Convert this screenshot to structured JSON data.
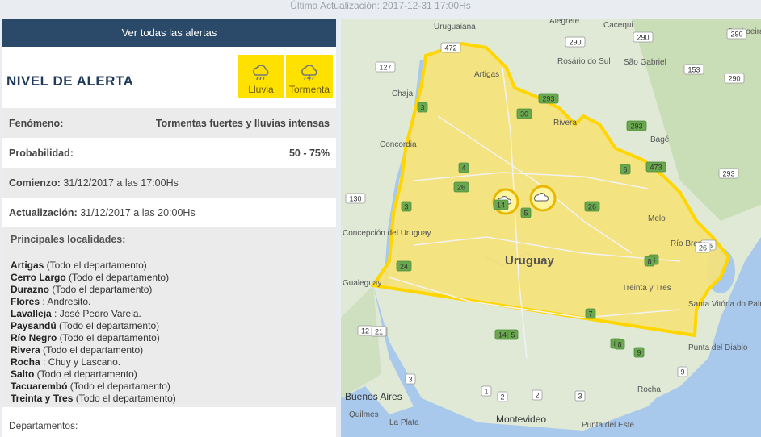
{
  "header": {
    "last_update": "Última Actualización: 2017-12-31 17:00Hs"
  },
  "panel": {
    "view_all_label": "Ver todas las alertas",
    "alert_level_title": "NIVEL DE ALERTA",
    "alert_icons": [
      {
        "label": "Lluvia",
        "icon": "rain-cloud-icon"
      },
      {
        "label": "Tormenta",
        "icon": "storm-cloud-icon"
      }
    ],
    "phenomenon_label": "Fenómeno:",
    "phenomenon_value": "Tormentas fuertes y lluvias intensas",
    "probability_label": "Probabilidad:",
    "probability_value": "50 - 75%",
    "start_label": "Comienzo:",
    "start_value": "31/12/2017 a las 17:00Hs",
    "update_label": "Actualización:",
    "update_value": "31/12/2017 a las 20:00Hs",
    "localities_title": "Principales localidades:",
    "localities": [
      {
        "name": "Artigas",
        "detail": "(Todo el departamento)"
      },
      {
        "name": "Cerro Largo",
        "detail": "(Todo el departamento)"
      },
      {
        "name": "Durazno",
        "detail": "(Todo el departamento)"
      },
      {
        "name": "Flores",
        "detail": ": Andresito."
      },
      {
        "name": "Lavalleja",
        "detail": ": José Pedro Varela."
      },
      {
        "name": "Paysandú",
        "detail": "(Todo el departamento)"
      },
      {
        "name": "Río Negro",
        "detail": "(Todo el departamento)"
      },
      {
        "name": "Rivera",
        "detail": "(Todo el departamento)"
      },
      {
        "name": "Rocha",
        "detail": ": Chuy y Lascano."
      },
      {
        "name": "Salto",
        "detail": "(Todo el departamento)"
      },
      {
        "name": "Tacuarembó",
        "detail": "(Todo el departamento)"
      },
      {
        "name": "Treinta y Tres",
        "detail": "(Todo el departamento)"
      }
    ],
    "departments_label": "Departamentos:"
  },
  "map": {
    "highlight_color": "#f5e27a",
    "border_color": "#ffd600",
    "cities": {
      "uruguaiana": "Uruguaiana",
      "alegrete": "Alegrete",
      "cacequi": "Cacequi",
      "rosario": "Rosário do Sul",
      "sao_gabriel": "São Gabriel",
      "cachoeira": "Cachoeira do Sul",
      "artigas": "Artigas",
      "chaja": "Chaja",
      "rivera": "Rivera",
      "bage": "Bagé",
      "concordia": "Concordia",
      "concepcion": "Concepción del Uruguay",
      "melo": "Melo",
      "rio_branco": "Río Branco",
      "uruguay": "Uruguay",
      "treinta_y_tres": "Treinta y Tres",
      "santa_vitoria": "Santa Vitória do Palmar",
      "gualeguay": "Gualeguay",
      "punta_diablo": "Punta del Diablo",
      "buenos_aires": "Buenos Aires",
      "quilmes": "Quilmes",
      "la_plata": "La Plata",
      "montevideo": "Montevideo",
      "punta_este": "Punta del Este",
      "rocha": "Rocha"
    },
    "routes": [
      "472",
      "290",
      "290",
      "290",
      "127",
      "293",
      "153",
      "290",
      "3",
      "30",
      "293",
      "473",
      "293",
      "4",
      "6",
      "26",
      "14",
      "26",
      "130",
      "3",
      "26",
      "26",
      "5",
      "8",
      "8",
      "24",
      "18",
      "8",
      "7",
      "12",
      "21",
      "14",
      "5",
      "8",
      "9",
      "1",
      "3",
      "9",
      "2",
      "3",
      "2"
    ]
  }
}
